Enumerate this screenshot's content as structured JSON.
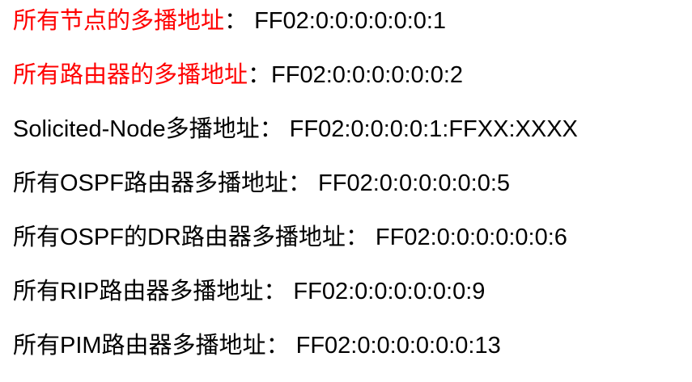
{
  "colors": {
    "highlight": "#ff0000",
    "text": "#000000",
    "background": "#ffffff"
  },
  "rows": [
    {
      "label": "所有节点的多播地址",
      "sep": "： ",
      "address": "FF02:0:0:0:0:0:0:1",
      "highlight": true
    },
    {
      "label": "所有路由器的多播地址",
      "sep": "：",
      "address": "FF02:0:0:0:0:0:0:2",
      "highlight": true
    },
    {
      "label": "Solicited-Node多播地址",
      "sep": "： ",
      "address": "FF02:0:0:0:0:1:FFXX:XXXX",
      "highlight": false
    },
    {
      "label": "所有OSPF路由器多播地址",
      "sep": "： ",
      "address": "FF02:0:0:0:0:0:0:5",
      "highlight": false
    },
    {
      "label": "所有OSPF的DR路由器多播地址",
      "sep": "： ",
      "address": "FF02:0:0:0:0:0:0:6",
      "highlight": false
    },
    {
      "label": "所有RIP路由器多播地址",
      "sep": "： ",
      "address": "FF02:0:0:0:0:0:0:9",
      "highlight": false
    },
    {
      "label": "所有PIM路由器多播地址",
      "sep": "： ",
      "address": "FF02:0:0:0:0:0:0:13",
      "highlight": false
    }
  ]
}
